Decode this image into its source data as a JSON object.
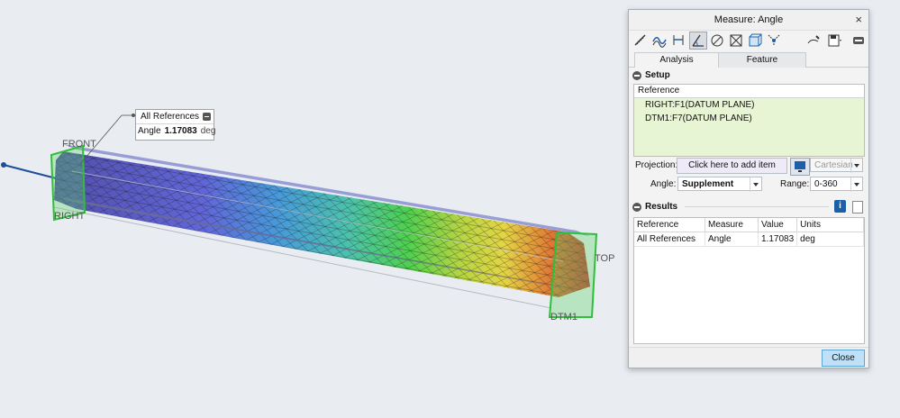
{
  "viewport": {
    "datum_labels": {
      "front": "FRONT",
      "right": "RIGHT",
      "top": "TOP",
      "dtm1": "DTM1"
    },
    "callout": {
      "title": "All References",
      "label": "Angle",
      "value": "1.17083",
      "unit": "deg"
    }
  },
  "dialog": {
    "title": "Measure: Angle",
    "close_glyph": "×",
    "toolbar_icons": [
      "length-icon",
      "distance-icon",
      "length-curve-icon",
      "angle-icon",
      "diameter-icon",
      "area-icon",
      "volume-icon",
      "transform-icon",
      "quick-measure-icon",
      "save-icon",
      "collapse-icon"
    ],
    "tabs": [
      "Analysis",
      "Feature"
    ],
    "setup": {
      "header": "Setup",
      "reference_header": "Reference",
      "references": [
        "RIGHT:F1(DATUM PLANE)",
        "DTM1:F7(DATUM PLANE)"
      ],
      "projection_label": "Projection:",
      "projection_button": "Click here to add item",
      "coordinate_system": "Cartesian",
      "angle_label": "Angle:",
      "angle_value": "Supplement",
      "range_label": "Range:",
      "range_value": "0-360"
    },
    "results": {
      "header": "Results",
      "columns": [
        "Reference",
        "Measure",
        "Value",
        "Units"
      ],
      "rows": [
        [
          "All References",
          "Angle",
          "1.17083",
          "deg"
        ]
      ]
    },
    "close_label": "Close"
  },
  "colors": {
    "accent": "#1c5fa8",
    "datum_green": "#2fbf3a",
    "selection_bg": "#e8f5d4",
    "close_button": "#bfe0f6"
  }
}
